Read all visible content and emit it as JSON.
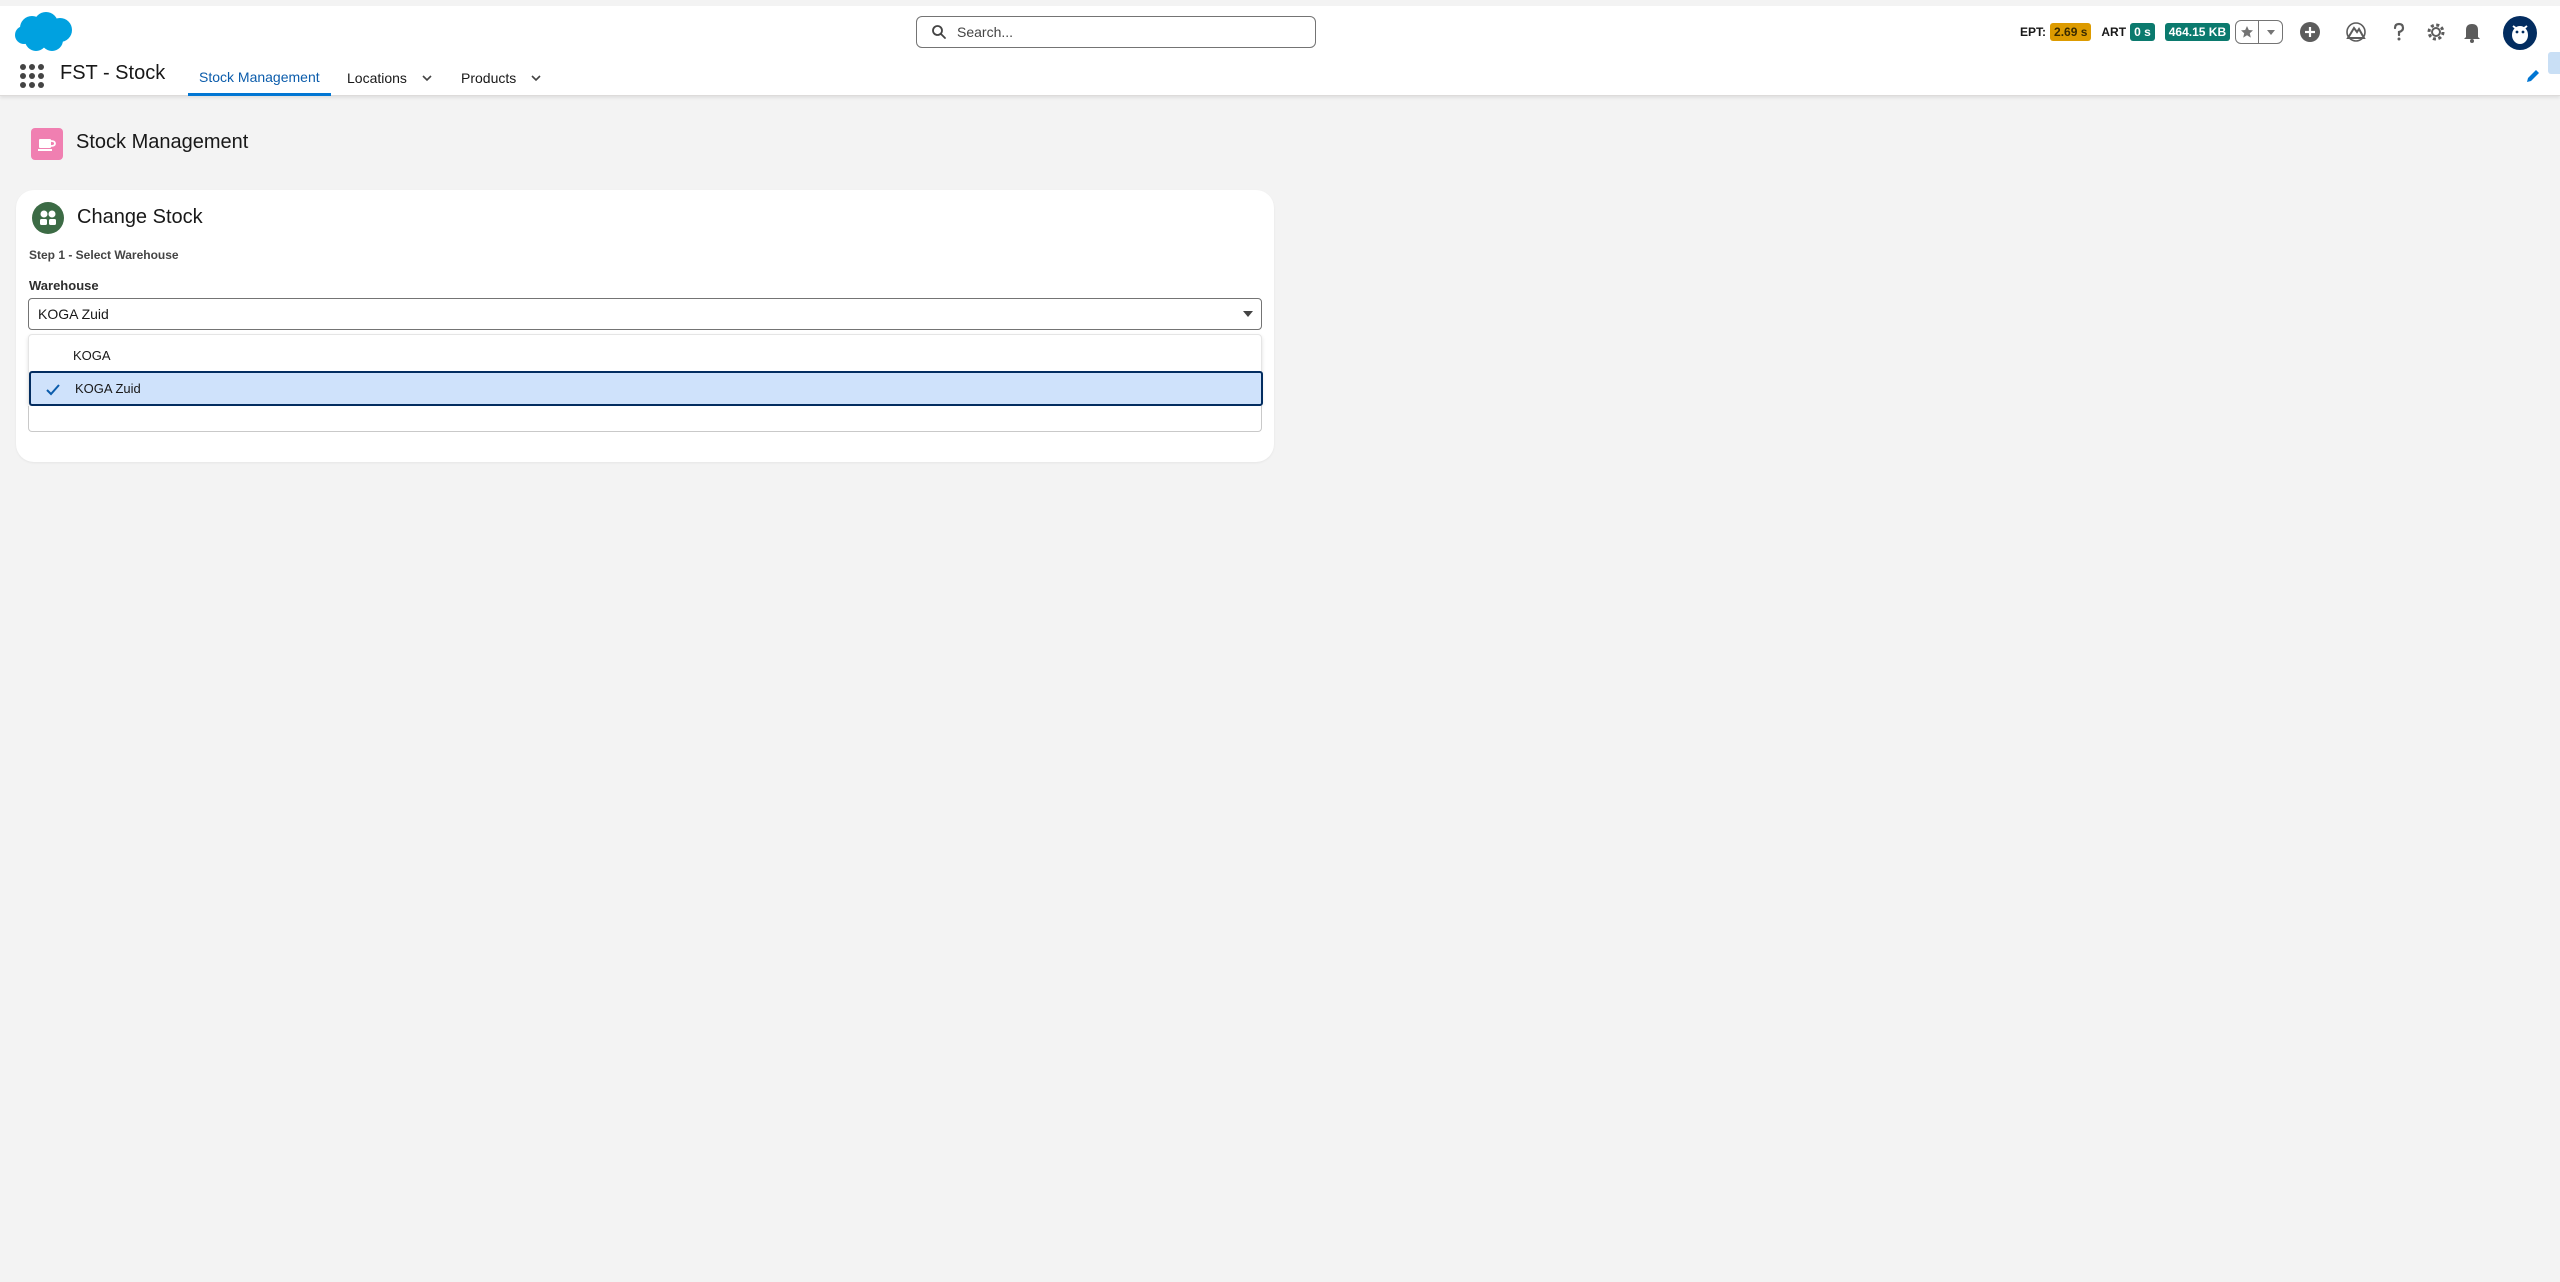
{
  "header": {
    "search_placeholder": "Search...",
    "metrics": {
      "ept_label": "EPT:",
      "ept_value": "2.69 s",
      "art_label": "ART",
      "art_value": "0 s",
      "size_value": "464.15 KB"
    },
    "icons": [
      "salesforce-logo",
      "star-icon",
      "chevron-down-icon",
      "add-icon",
      "trailhead-icon",
      "help-icon",
      "setup-gear-icon",
      "notification-bell-icon",
      "user-avatar"
    ]
  },
  "nav": {
    "app_name": "FST - Stock",
    "tabs": [
      {
        "label": "Stock Management",
        "active": true
      },
      {
        "label": "Locations",
        "active": false
      },
      {
        "label": "Products",
        "active": false
      }
    ]
  },
  "page": {
    "title": "Stock Management"
  },
  "card": {
    "title": "Change Stock",
    "step": "Step 1 - Select Warehouse",
    "field_label": "Warehouse",
    "selected_value": "KOGA Zuid",
    "options": [
      {
        "label": "KOGA",
        "selected": false
      },
      {
        "label": "KOGA Zuid",
        "selected": true
      }
    ]
  },
  "colors": {
    "brand_blue": "#0176d3",
    "active_tab_text": "#0b5cab",
    "selected_option_bg": "#cfe2fb",
    "page_icon_pink": "#f07fb1",
    "card_icon_green": "#3c6b45",
    "ept_badge": "#dd9b00",
    "ok_badge": "#0b7a6e"
  }
}
